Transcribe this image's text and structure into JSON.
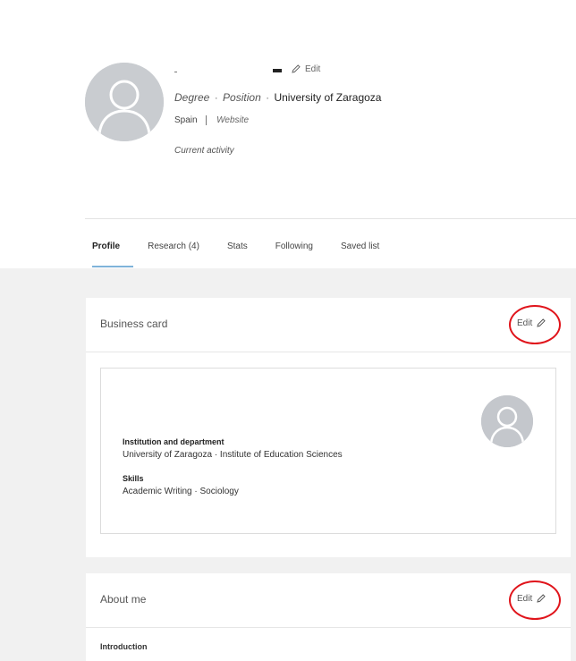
{
  "header": {
    "edit_label": "Edit",
    "degree": "Degree",
    "position": "Position",
    "separator": "·",
    "institution": "University of Zaragoza",
    "country": "Spain",
    "website": "Website",
    "current_activity": "Current activity"
  },
  "tabs": [
    {
      "label": "Profile",
      "active": true
    },
    {
      "label": "Research (4)",
      "active": false
    },
    {
      "label": "Stats",
      "active": false
    },
    {
      "label": "Following",
      "active": false
    },
    {
      "label": "Saved list",
      "active": false
    }
  ],
  "business_card": {
    "title": "Business card",
    "edit_label": "Edit",
    "institution_label": "Institution and department",
    "institution_value": "University of Zaragoza · Institute of Education Sciences",
    "skills_label": "Skills",
    "skills_value": "Academic Writing · Sociology"
  },
  "about_me": {
    "title": "About me",
    "edit_label": "Edit",
    "introduction_label": "Introduction"
  },
  "colors": {
    "highlight_ring": "#e0141b",
    "tab_underline": "#7fb3da",
    "avatar": "#c9ccd0",
    "body_bg": "#f1f1f1"
  },
  "icons": [
    "avatar-placeholder-icon",
    "pencil-icon"
  ]
}
